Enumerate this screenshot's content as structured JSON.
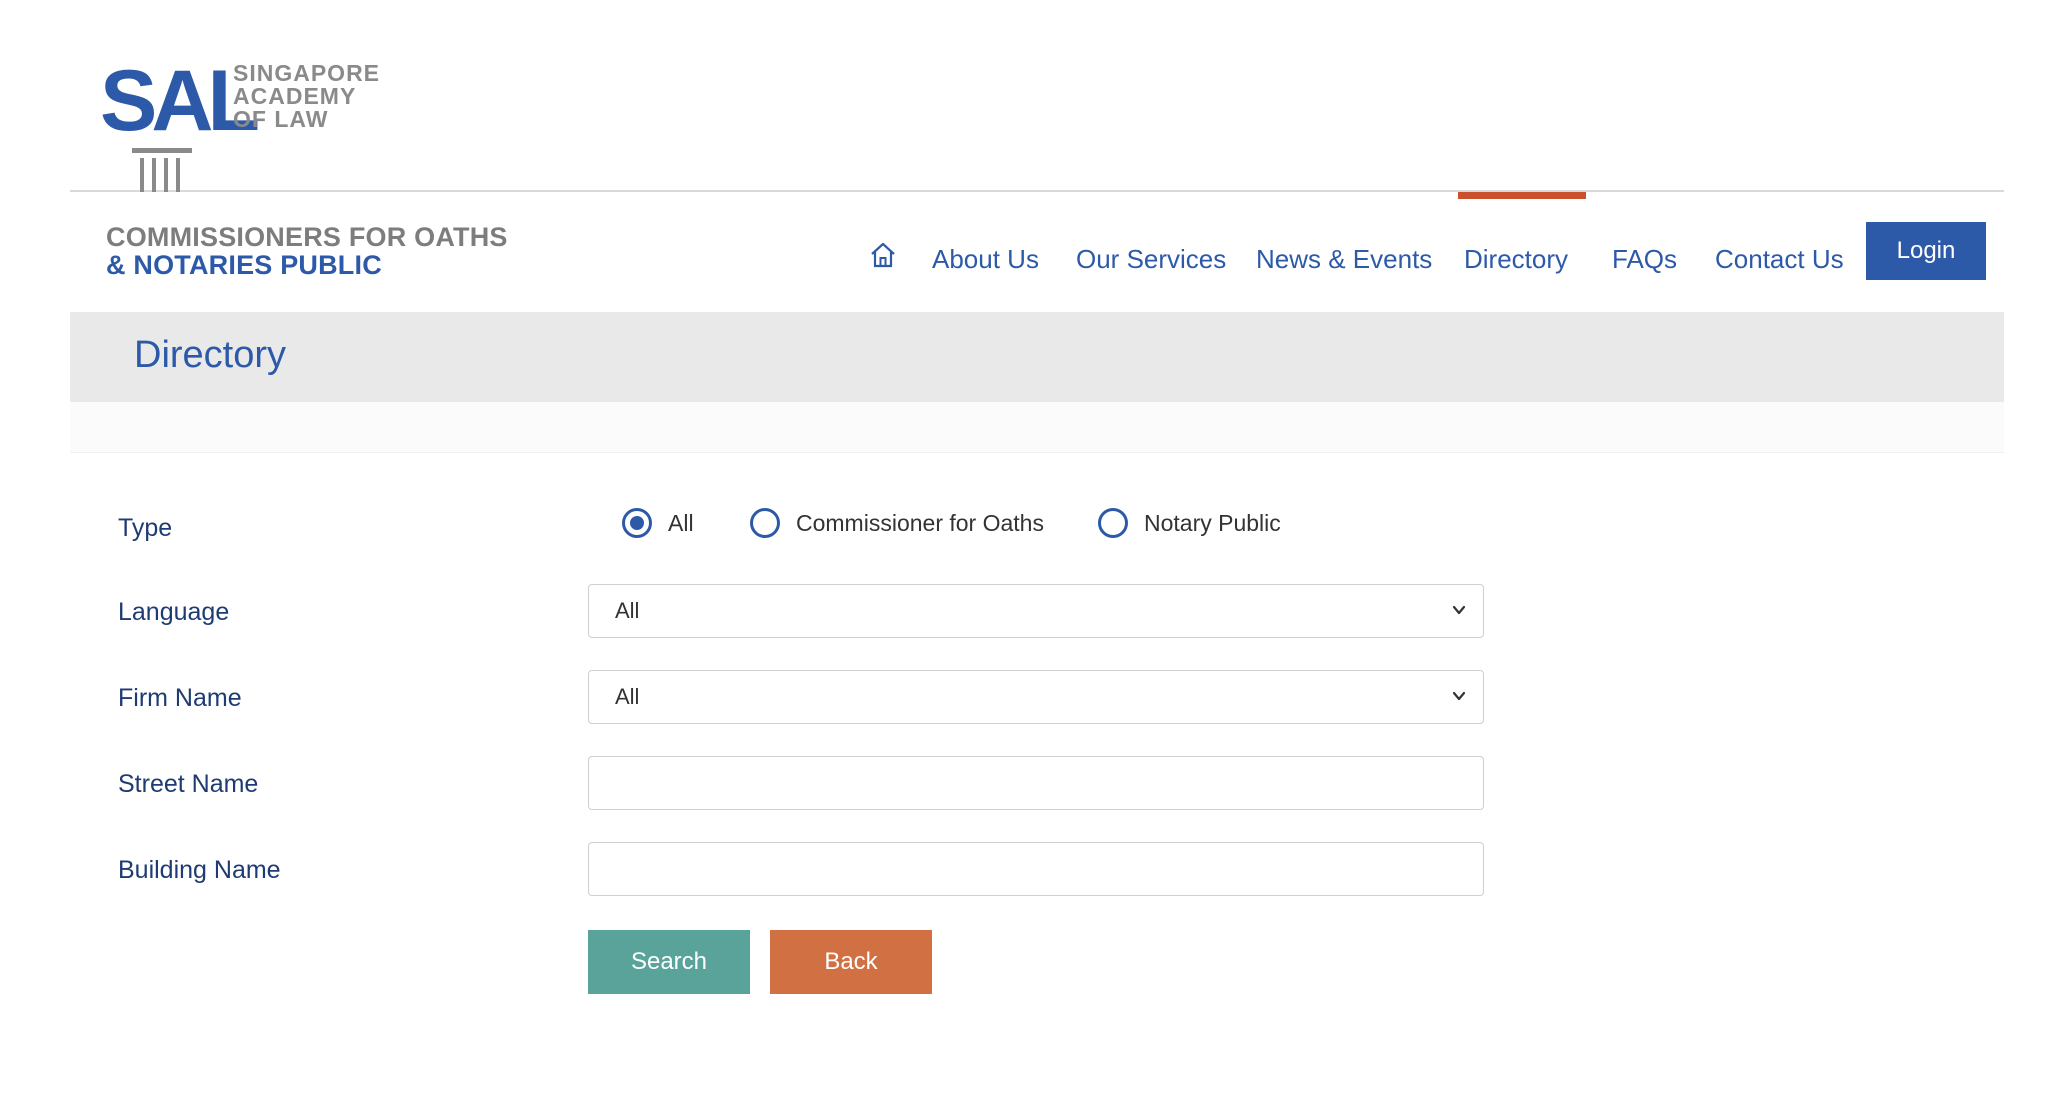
{
  "logo": {
    "mark_text": "SAL",
    "line1": "SINGAPORE",
    "line2": "ACADEMY",
    "line3": "OF LAW"
  },
  "brand": {
    "line1": "COMMISSIONERS FOR OATHS",
    "line2": "& NOTARIES PUBLIC"
  },
  "nav": {
    "home_icon": "home-icon",
    "items": [
      {
        "label": "About Us"
      },
      {
        "label": "Our Services"
      },
      {
        "label": "News & Events"
      },
      {
        "label": "Directory",
        "active": true
      },
      {
        "label": "FAQs"
      },
      {
        "label": "Contact Us"
      }
    ],
    "login_label": "Login"
  },
  "page": {
    "title": "Directory"
  },
  "form": {
    "type": {
      "label": "Type",
      "options": [
        {
          "label": "All",
          "checked": true
        },
        {
          "label": "Commissioner for Oaths",
          "checked": false
        },
        {
          "label": "Notary Public",
          "checked": false
        }
      ]
    },
    "language": {
      "label": "Language",
      "value": "All"
    },
    "firm_name": {
      "label": "Firm Name",
      "value": "All"
    },
    "street_name": {
      "label": "Street Name",
      "value": "",
      "placeholder": ""
    },
    "building_name": {
      "label": "Building Name",
      "value": "",
      "placeholder": ""
    },
    "search_label": "Search",
    "back_label": "Back"
  },
  "colors": {
    "primary": "#2d5aa8",
    "active_underline": "#c9512c",
    "search_button": "#5aa39b",
    "back_button": "#d07043",
    "title_band": "#e9e9e9"
  }
}
